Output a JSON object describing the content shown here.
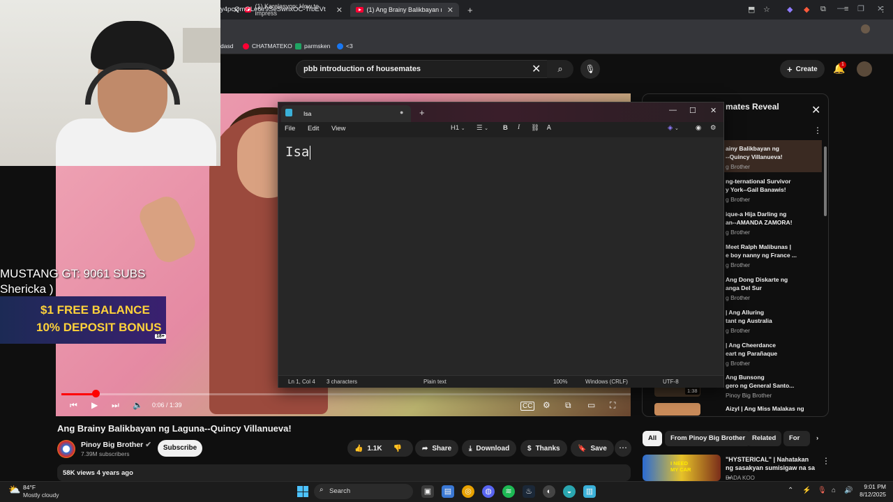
{
  "browser": {
    "tabs": [
      {
        "label": "(1) Karelasyon: How to impress",
        "close": "✕"
      },
      {
        "label": "(1) Ang Brainy Balikbayan ng La",
        "close": "✕"
      }
    ],
    "new_tab": "+",
    "url": "y4pcQmOLe6lr9SeSwnxOC-TrbEVt",
    "bookmarks": [
      "dasd",
      "CHATMATEKO",
      "parmsken",
      "<3"
    ]
  },
  "youtube": {
    "search_query": "pbb introduction of housemates",
    "create_label": "Create",
    "notification_count": "1",
    "video": {
      "time": "0:06 / 1:39",
      "progress_fraction": 0.06,
      "title": "Ang Brainy Balikbayan ng Laguna--Quincy Villanueva!",
      "channel": "Pinoy Big Brother",
      "subscribers": "7.39M subscribers",
      "subscribe_label": "Subscribe",
      "likes": "1.1K",
      "share_label": "Share",
      "download_label": "Download",
      "thanks_label": "Thanks",
      "save_label": "Save",
      "views_line": "58K views  4 years ago"
    },
    "playlist": {
      "title": "mates Reveal",
      "items": [
        {
          "title": "ainy Balikbayan ng\n--Quincy Villanueva!",
          "channel": "g Brother"
        },
        {
          "title": "ng-ternational Survivor\ny York--Gail Banawis!",
          "channel": "g Brother"
        },
        {
          "title": "ique-a Hija Darling ng\nan--AMANDA ZAMORA!",
          "channel": "g Brother"
        },
        {
          "title": "Meet Ralph Malibunas |\ne boy nanny ng France ...",
          "channel": "g Brother"
        },
        {
          "title": "Ang Dong Diskarte ng\nanga Del Sur",
          "channel": "g Brother"
        },
        {
          "title": "| Ang Alluring\ntant ng Australia",
          "channel": "g Brother"
        },
        {
          "title": "| Ang Cheerdance\neart ng Parañaque",
          "channel": "g Brother"
        },
        {
          "title": "Ang Bunsong\ngero ng General Santo...",
          "channel": "Pinoy Big Brother"
        },
        {
          "title": "Aizyl | Ang Miss Malakas ng",
          "channel": ""
        }
      ],
      "duration_badge": "1:38"
    },
    "chips": [
      "All",
      "From Pinoy Big Brother",
      "Related",
      "For y"
    ],
    "recommendation": {
      "thumb_text": "I NEED MY CAR",
      "title": "\"HYSTERICAL\" | Nahatakan ng sasakyan sumisigaw na sa ...",
      "channel": "DADA KOO"
    }
  },
  "stream_overlay": {
    "line1": "MUSTANG GT: 9061 SUBS",
    "line2": "Shericka )",
    "promo_line1": "$1 FREE BALANCE",
    "promo_line2": "10% DEPOSIT BONUS",
    "promo_age": "18+"
  },
  "notepad": {
    "tab_name": "Isa",
    "menu": [
      "File",
      "Edit",
      "View"
    ],
    "heading_label": "H1",
    "content": "Isa",
    "status": {
      "position": "Ln 1, Col 4",
      "chars": "3 characters",
      "format": "Plain text",
      "zoom": "100%",
      "line_ending": "Windows (CRLF)",
      "encoding": "UTF-8"
    }
  },
  "taskbar": {
    "temp": "84°F",
    "weather": "Mostly cloudy",
    "search_label": "Search",
    "time": "9:01 PM",
    "date": "8/12/2025"
  }
}
